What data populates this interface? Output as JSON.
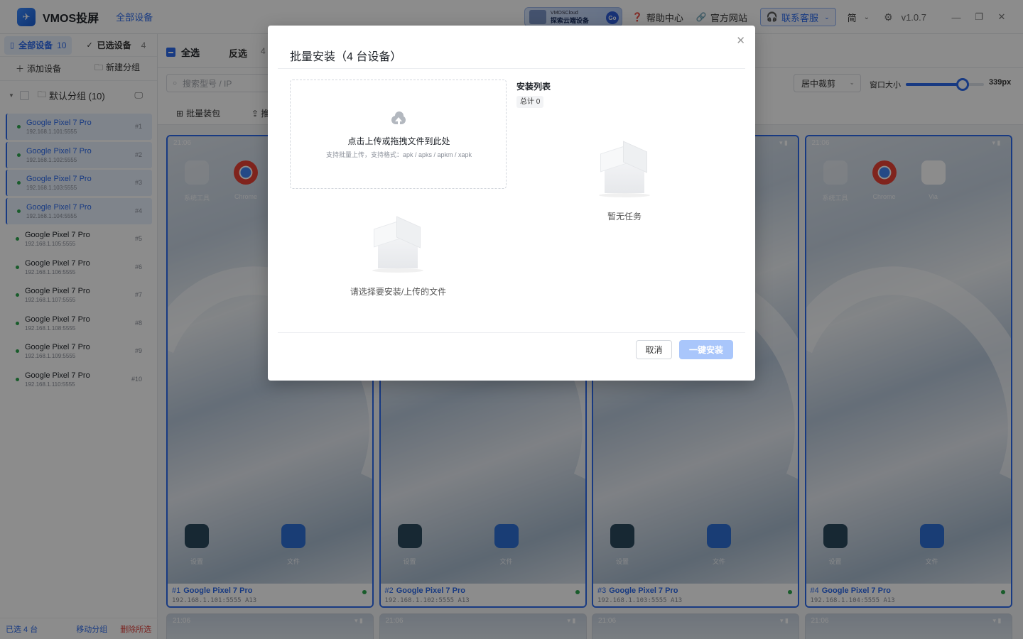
{
  "app": {
    "title": "VMOS投屏",
    "logo_glyph": "✈",
    "top_tab": "全部设备",
    "promo_small": "VMOSCloud",
    "promo_big": "探索云端设备",
    "promo_go": "Go",
    "help": "帮助中心",
    "website": "官方网站",
    "contact": "联系客服",
    "lang": "简",
    "version": "v1.0.7",
    "accent": "#2c6bed"
  },
  "sidebar": {
    "tab_all": "全部设备",
    "tab_all_count": "10",
    "tab_selected": "已选设备",
    "tab_selected_count": "4",
    "add_device": "添加设备",
    "new_group": "新建分组",
    "group_name": "默认分组 (10)",
    "devices": [
      {
        "name": "Google Pixel 7 Pro",
        "ip": "192.168.1.101:5555",
        "num": "#1",
        "selected": true
      },
      {
        "name": "Google Pixel 7 Pro",
        "ip": "192.168.1.102:5555",
        "num": "#2",
        "selected": true
      },
      {
        "name": "Google Pixel 7 Pro",
        "ip": "192.168.1.103:5555",
        "num": "#3",
        "selected": true
      },
      {
        "name": "Google Pixel 7 Pro",
        "ip": "192.168.1.104:5555",
        "num": "#4",
        "selected": true
      },
      {
        "name": "Google Pixel 7 Pro",
        "ip": "192.168.1.105:5555",
        "num": "#5",
        "selected": false
      },
      {
        "name": "Google Pixel 7 Pro",
        "ip": "192.168.1.106:5555",
        "num": "#6",
        "selected": false
      },
      {
        "name": "Google Pixel 7 Pro",
        "ip": "192.168.1.107:5555",
        "num": "#7",
        "selected": false
      },
      {
        "name": "Google Pixel 7 Pro",
        "ip": "192.168.1.108:5555",
        "num": "#8",
        "selected": false
      },
      {
        "name": "Google Pixel 7 Pro",
        "ip": "192.168.1.109:5555",
        "num": "#9",
        "selected": false
      },
      {
        "name": "Google Pixel 7 Pro",
        "ip": "192.168.1.110:5555",
        "num": "#10",
        "selected": false
      }
    ],
    "footer_selected": "已选 4 台",
    "footer_move": "移动分组",
    "footer_delete": "删除所选"
  },
  "toolbar": {
    "select_all": "全选",
    "invert": "反选",
    "invert_count": "4",
    "search_placeholder": "搜索型号 / IP",
    "crop_mode": "居中裁剪",
    "window_size_label": "窗口大小",
    "window_size_value": "339px",
    "window_size_fraction": 0.73,
    "batch_install": "批量装包",
    "push_partial": "推"
  },
  "cards": [
    {
      "num": "#1",
      "name": "Google Pixel 7 Pro",
      "ip": "192.168.1.101:5555 A13",
      "time": "21:06"
    },
    {
      "num": "#2",
      "name": "Google Pixel 7 Pro",
      "ip": "192.168.1.102:5555 A13",
      "time": "21:06"
    },
    {
      "num": "#3",
      "name": "Google Pixel 7 Pro",
      "ip": "192.168.1.103:5555 A13",
      "time": "21:06"
    },
    {
      "num": "#4",
      "name": "Google Pixel 7 Pro",
      "ip": "192.168.1.104:5555 A13",
      "time": "21:06"
    }
  ],
  "apps": {
    "tools": "系统工具",
    "chrome": "Chrome",
    "via": "Via",
    "settings": "设置",
    "files": "文件"
  },
  "modal": {
    "title": "批量安装（4 台设备）",
    "upload_main": "点击上传或拖拽文件到此处",
    "upload_sub": "支持批量上传，支持格式：apk / apks / apkm / xapk",
    "empty_left": "请选择要安装/上传的文件",
    "list_title": "安装列表",
    "list_count": "总计 0",
    "empty_right": "暂无任务",
    "cancel": "取消",
    "install": "一键安装"
  }
}
